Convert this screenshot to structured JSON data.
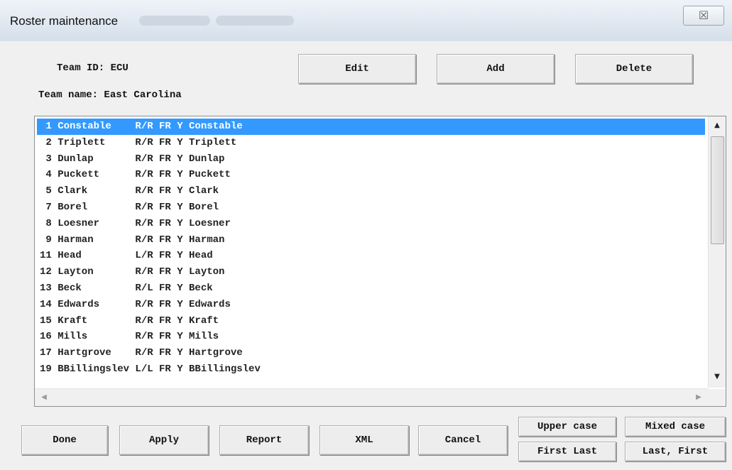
{
  "window": {
    "title": "Roster maintenance",
    "close_glyph": "☒"
  },
  "header": {
    "team_id": "Team ID: ECU",
    "team_name": "Team name: East Carolina"
  },
  "top_buttons": {
    "edit": "Edit",
    "add": "Add",
    "delete": "Delete"
  },
  "roster": {
    "selected_index": 0,
    "rows": [
      " 1 Constable    R/R FR Y Constable",
      " 2 Triplett     R/R FR Y Triplett",
      " 3 Dunlap       R/R FR Y Dunlap",
      " 4 Puckett      R/R FR Y Puckett",
      " 5 Clark        R/R FR Y Clark",
      " 7 Borel        R/R FR Y Borel",
      " 8 Loesner      R/R FR Y Loesner",
      " 9 Harman       R/R FR Y Harman",
      "11 Head         L/R FR Y Head",
      "12 Layton       R/R FR Y Layton",
      "13 Beck         R/L FR Y Beck",
      "14 Edwards      R/R FR Y Edwards",
      "15 Kraft        R/R FR Y Kraft",
      "16 Mills        R/R FR Y Mills",
      "17 Hartgrove    R/R FR Y Hartgrove",
      "19 BBillingslev L/L FR Y BBillingslev"
    ]
  },
  "bottom_buttons": {
    "done": "Done",
    "apply": "Apply",
    "report": "Report",
    "xml": "XML",
    "cancel": "Cancel",
    "upper_case": "Upper case",
    "mixed_case": "Mixed case",
    "first_last": "First Last",
    "last_first": "Last, First"
  },
  "scroll_glyphs": {
    "up": "▲",
    "down": "▼",
    "left": "◀",
    "right": "▶"
  },
  "colors": {
    "selection": "#3399ff",
    "window_bg": "#f0f0f0"
  }
}
